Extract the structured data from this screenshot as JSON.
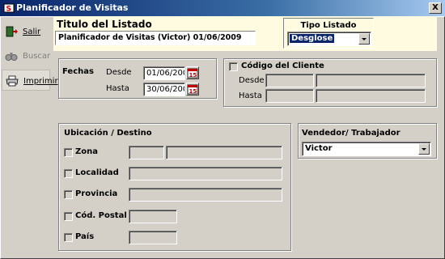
{
  "window": {
    "title": "Planificador de Visitas",
    "close_glyph": "X"
  },
  "toolbar": {
    "salir": "Salir",
    "buscar": "Buscar",
    "imprimir": "Imprimir"
  },
  "header": {
    "titulo_label": "Titulo del Listado",
    "titulo_value": "Planificador de Visitas (Victor) 01/06/2009",
    "tipo_label": "Tipo Listado",
    "tipo_value": "Desglose"
  },
  "fechas": {
    "label": "Fechas",
    "desde_label": "Desde",
    "desde_value": "01/06/2009",
    "hasta_label": "Hasta",
    "hasta_value": "30/06/2009"
  },
  "codigo_cliente": {
    "label": "Código del Cliente",
    "desde_label": "Desde",
    "hasta_label": "Hasta"
  },
  "ubicacion": {
    "label": "Ubicación / Destino",
    "zona": "Zona",
    "localidad": "Localidad",
    "provincia": "Provincia",
    "cod_postal": "Cód. Postal",
    "pais": "País"
  },
  "vendedor": {
    "label": "Vendedor/ Trabajador",
    "value": "Victor"
  }
}
